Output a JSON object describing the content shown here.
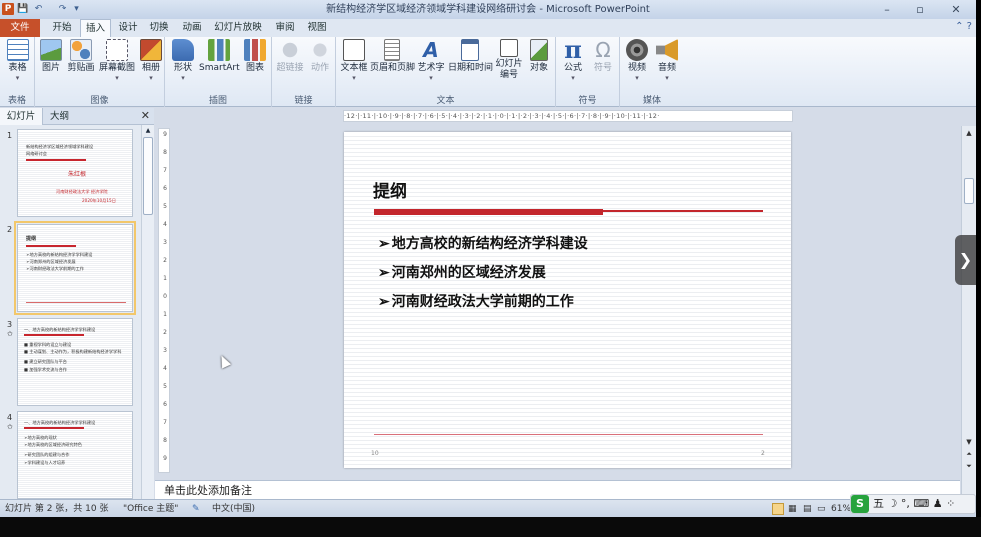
{
  "window": {
    "title": "新结构经济学区域经济领域学科建设网络研讨会 - Microsoft PowerPoint",
    "app_icon": "P",
    "controls": [
      "–",
      "▫",
      "✕"
    ]
  },
  "quick_access": [
    "💾",
    "↶",
    "↷",
    "▾"
  ],
  "tabs": {
    "file": "文件",
    "items": [
      "开始",
      "插入",
      "设计",
      "切换",
      "动画",
      "幻灯片放映",
      "审阅",
      "视图"
    ],
    "active": "插入",
    "help": "⌃ ?"
  },
  "ribbon": {
    "groups": {
      "table": {
        "label": "表格",
        "buttons": [
          {
            "label": "表格",
            "icon": "table-icon"
          }
        ]
      },
      "images": {
        "label": "图像",
        "buttons": [
          {
            "label": "图片",
            "icon": "picture-icon"
          },
          {
            "label": "剪贴画",
            "icon": "clipart-icon"
          },
          {
            "label": "屏幕截图",
            "icon": "screenshot-icon"
          },
          {
            "label": "相册",
            "icon": "album-icon"
          }
        ]
      },
      "illustrations": {
        "label": "插图",
        "buttons": [
          {
            "label": "形状",
            "icon": "shapes-icon"
          },
          {
            "label": "SmartArt",
            "icon": "smartart-icon"
          },
          {
            "label": "图表",
            "icon": "chart-icon"
          }
        ]
      },
      "links": {
        "label": "链接",
        "buttons": [
          {
            "label": "超链接",
            "icon": "hyperlink-icon"
          },
          {
            "label": "动作",
            "icon": "action-icon"
          }
        ]
      },
      "text": {
        "label": "文本",
        "buttons": [
          {
            "label": "文本框",
            "icon": "textbox-icon"
          },
          {
            "label": "页眉和页脚",
            "icon": "header-footer-icon"
          },
          {
            "label": "艺术字",
            "icon": "wordart-icon"
          },
          {
            "label": "日期和时间",
            "icon": "datetime-icon"
          },
          {
            "label": "幻灯片",
            "label2": "编号",
            "icon": "slide-number-icon"
          },
          {
            "label": "对象",
            "icon": "object-icon"
          }
        ]
      },
      "symbols": {
        "label": "符号",
        "buttons": [
          {
            "label": "公式",
            "icon": "equation-icon"
          },
          {
            "label": "符号",
            "icon": "symbol-icon"
          }
        ]
      },
      "media": {
        "label": "媒体",
        "buttons": [
          {
            "label": "视频",
            "icon": "video-icon"
          },
          {
            "label": "音频",
            "icon": "audio-icon"
          }
        ]
      }
    }
  },
  "left_panel": {
    "tab_slides": "幻灯片",
    "tab_outline": "大纲",
    "close": "✕",
    "thumbnails": [
      {
        "num": "1",
        "lines": [
          "新结构经济学区域经济领域学科建设",
          "网络研讨会"
        ],
        "author": "朱红根",
        "org": "河南财经政法大学 经济学院",
        "date": "2020年10月15日"
      },
      {
        "num": "2",
        "title": "提纲",
        "lines": [
          "➢地方高校的新结构经济学学科建设",
          "➢河南郑州的区域经济发展",
          "➢河南财经政法大学前期的工作"
        ]
      },
      {
        "num": "3",
        "title": "一、地方高校的新结构经济学学科建设",
        "lines": [
          "■ 重视学科的设立与建设",
          "■ 主动谋划、主动作为，积极构建新结构经济学学科",
          "■ 建立研究团队与平台",
          "■ 加强学术交流与合作"
        ]
      },
      {
        "num": "4",
        "title": "一、地方高校的新结构经济学学科建设",
        "lines": [
          "➢地方高校的现状",
          "➢地方高校的区域经济研究特色",
          "➢研究团队的组建与合作",
          "➢学科建设与人才培养"
        ]
      }
    ]
  },
  "ruler": {
    "horizontal": "·12·|·11·|·10·|·9·|·8·|·7·|·6·|·5·|·4·|·3·|·2·|·1·|·0·|·1·|·2·|·3·|·4·|·5·|·6·|·7·|·8·|·9·|·10·|·11·|·12·",
    "vertical": [
      "9",
      "8",
      "7",
      "6",
      "5",
      "4",
      "3",
      "2",
      "1",
      "0",
      "1",
      "2",
      "3",
      "4",
      "5",
      "6",
      "7",
      "8",
      "9"
    ]
  },
  "slide": {
    "title": "提纲",
    "bullets": [
      {
        "arrow": "➢",
        "text": "地方高校的新结构经济学科建设"
      },
      {
        "arrow": "➢",
        "text": "河南郑州的区域经济发展"
      },
      {
        "arrow": "➢",
        "text": "河南财经政法大学前期的工作"
      }
    ],
    "footer_left": "10",
    "footer_right": "2"
  },
  "notes": {
    "placeholder": "单击此处添加备注"
  },
  "status": {
    "slide_info": "幻灯片 第 2 张，共 10 张",
    "theme": "\"Office 主题\"",
    "language": "中文(中国)",
    "zoom": "61%"
  },
  "ime": {
    "logo": "S",
    "text": "五 ☽ °, ⌨ ♟ ⁘"
  },
  "nav_arrow": "❯",
  "colors": {
    "accent_red": "#c3262c",
    "file_tab": "#c6502a",
    "selection": "#f2c76b"
  }
}
